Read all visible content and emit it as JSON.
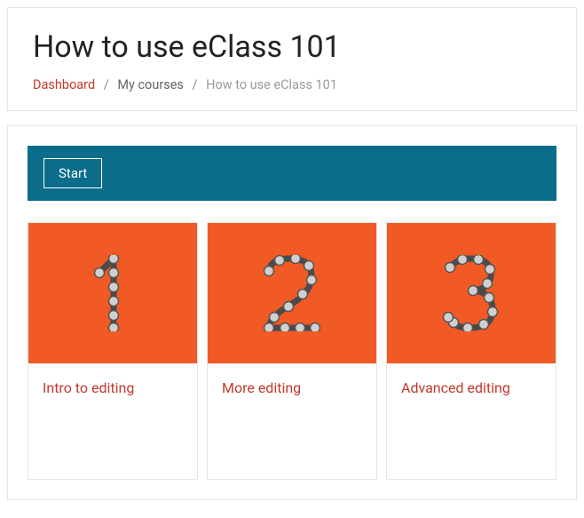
{
  "header": {
    "title": "How to use eClass 101",
    "breadcrumb": {
      "dashboard": "Dashboard",
      "my_courses": "My courses",
      "current": "How to use eClass 101"
    }
  },
  "banner": {
    "start_label": "Start"
  },
  "tiles": [
    {
      "number": "1",
      "title": "Intro to editing"
    },
    {
      "number": "2",
      "title": "More editing"
    },
    {
      "number": "3",
      "title": "Advanced editing"
    }
  ]
}
